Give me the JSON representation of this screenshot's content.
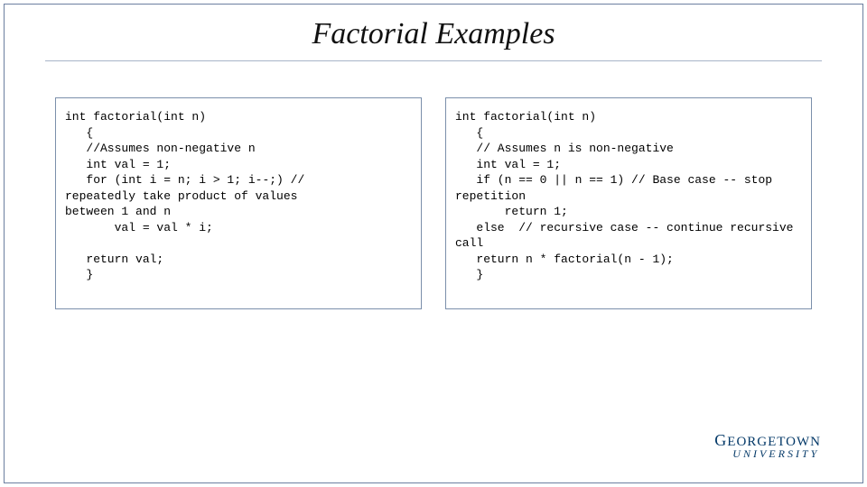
{
  "title": "Factorial Examples",
  "code_left": "int factorial(int n)\n   {\n   //Assumes non-negative n\n   int val = 1;\n   for (int i = n; i > 1; i--;) //\nrepeatedly take product of values\nbetween 1 and n\n       val = val * i;\n\n   return val;\n   }",
  "code_right": "int factorial(int n)\n   {\n   // Assumes n is non-negative\n   int val = 1;\n   if (n == 0 || n == 1) // Base case -- stop repetition\n       return 1;\n   else  // recursive case -- continue recursive call\n   return n * factorial(n - 1);\n   }",
  "logo": {
    "line1_rest": "EORGETOWN",
    "line2": "UNIVERSITY"
  }
}
